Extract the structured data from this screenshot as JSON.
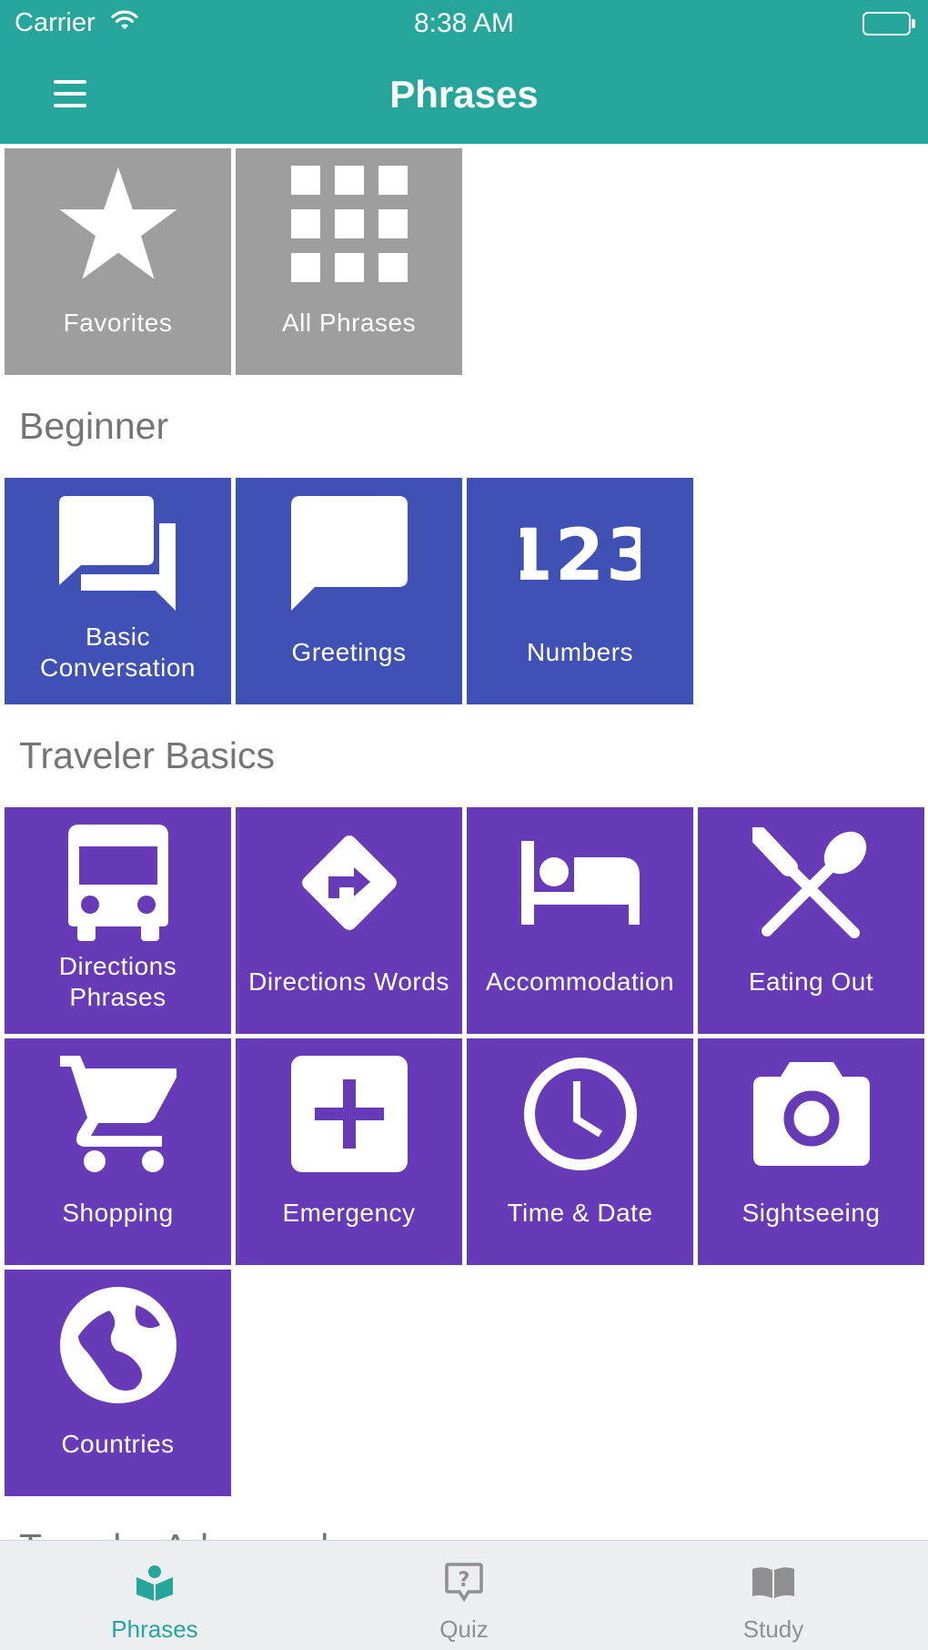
{
  "status_bar": {
    "carrier": "Carrier",
    "time": "8:38 AM"
  },
  "header": {
    "title": "Phrases",
    "menu_icon": "hamburger-menu-icon"
  },
  "top_tiles": [
    {
      "label": "Favorites",
      "icon": "star-icon",
      "color": "#9e9e9e"
    },
    {
      "label": "All Phrases",
      "icon": "grid-icon",
      "color": "#9e9e9e"
    }
  ],
  "sections": [
    {
      "title": "Beginner",
      "color": "#3f51b5",
      "tiles": [
        {
          "label": "Basic Conversation",
          "icon": "conversation-icon"
        },
        {
          "label": "Greetings",
          "icon": "speech-bubble-icon"
        },
        {
          "label": "Numbers",
          "icon": "numbers-123-icon"
        }
      ]
    },
    {
      "title": "Traveler Basics",
      "color": "#673ab7",
      "tiles": [
        {
          "label": "Directions Phrases",
          "icon": "bus-icon"
        },
        {
          "label": "Directions Words",
          "icon": "directions-sign-icon"
        },
        {
          "label": "Accommodation",
          "icon": "bed-icon"
        },
        {
          "label": "Eating Out",
          "icon": "utensils-icon"
        },
        {
          "label": "Shopping",
          "icon": "cart-icon"
        },
        {
          "label": "Emergency",
          "icon": "medical-plus-icon"
        },
        {
          "label": "Time & Date",
          "icon": "clock-icon"
        },
        {
          "label": "Sightseeing",
          "icon": "camera-icon"
        },
        {
          "label": "Countries",
          "icon": "globe-icon"
        }
      ]
    },
    {
      "title": "Traveler Advanced"
    }
  ],
  "tab_bar": {
    "active_color": "#26a69a",
    "tabs": [
      {
        "label": "Phrases",
        "icon": "book-reader-icon",
        "active": true
      },
      {
        "label": "Quiz",
        "icon": "quiz-bubble-icon",
        "active": false
      },
      {
        "label": "Study",
        "icon": "open-book-icon",
        "active": false
      }
    ]
  }
}
